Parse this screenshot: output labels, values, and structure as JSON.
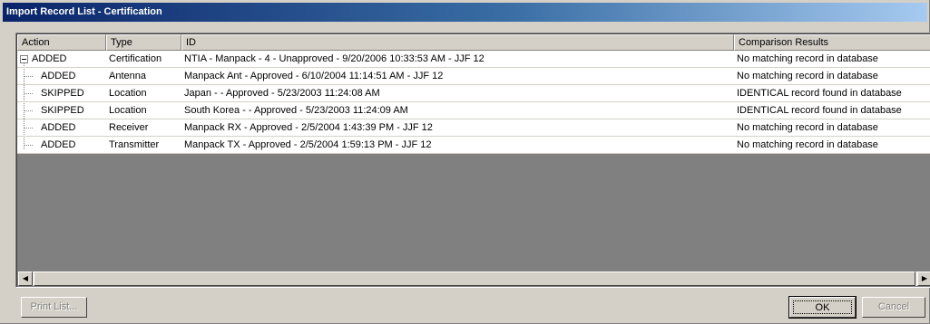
{
  "window": {
    "title": "Import Record List - Certification"
  },
  "table": {
    "columns": [
      "Action",
      "Type",
      "ID",
      "Comparison Results"
    ],
    "rows": [
      {
        "action": "ADDED",
        "type": "Certification",
        "id": "NTIA - Manpack - 4 - Unapproved - 9/20/2006 10:33:53 AM - JJF 12",
        "result": "No matching record in database",
        "level": 0
      },
      {
        "action": "ADDED",
        "type": "Antenna",
        "id": "Manpack Ant - Approved - 6/10/2004 11:14:51 AM - JJF 12",
        "result": "No matching record in database",
        "level": 1
      },
      {
        "action": "SKIPPED",
        "type": "Location",
        "id": "Japan - - Approved - 5/23/2003 11:24:08 AM",
        "result": "IDENTICAL record found in database",
        "level": 1
      },
      {
        "action": "SKIPPED",
        "type": "Location",
        "id": "South Korea - - Approved - 5/23/2003 11:24:09 AM",
        "result": "IDENTICAL record found in database",
        "level": 1
      },
      {
        "action": "ADDED",
        "type": "Receiver",
        "id": "Manpack RX - Approved - 2/5/2004 1:43:39 PM - JJF 12",
        "result": "No matching record in database",
        "level": 1
      },
      {
        "action": "ADDED",
        "type": "Transmitter",
        "id": "Manpack TX - Approved - 2/5/2004 1:59:13 PM - JJF 12",
        "result": "No matching record in database",
        "level": 1
      }
    ]
  },
  "scrollbar": {
    "left_arrow": "◀",
    "right_arrow": "▶"
  },
  "buttons": {
    "print_list": "Print List...",
    "ok": "OK",
    "cancel": "Cancel"
  }
}
